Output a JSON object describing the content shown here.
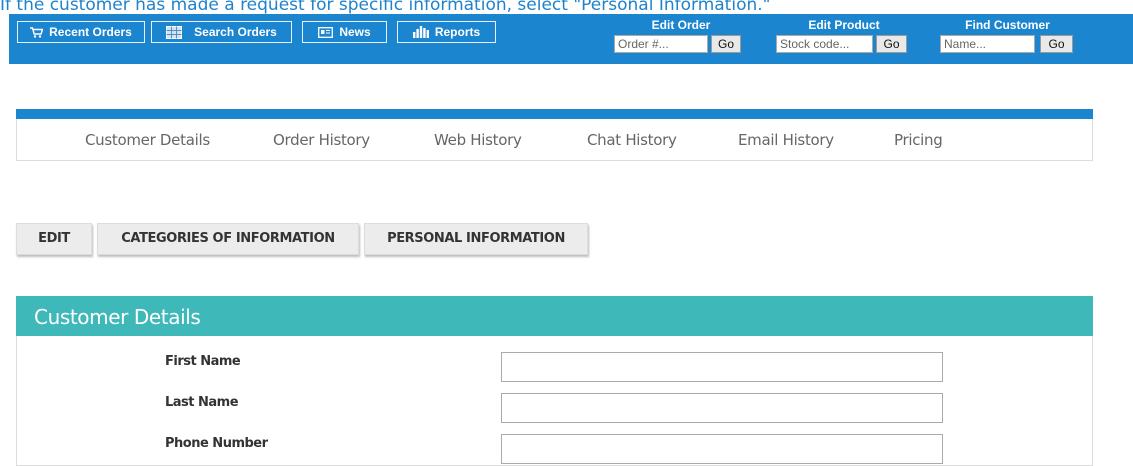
{
  "instruction": "If the customer has made a request for specific information, select \"Personal Information.\"",
  "topbar": {
    "nav": [
      {
        "label": "Recent Orders",
        "icon": "cart-icon"
      },
      {
        "label": "Search Orders",
        "icon": "grid-icon"
      },
      {
        "label": "News",
        "icon": "newspaper-icon"
      },
      {
        "label": "Reports",
        "icon": "bar-chart-icon"
      }
    ],
    "quick": [
      {
        "title": "Edit Order",
        "placeholder": "Order #...",
        "button": "Go"
      },
      {
        "title": "Edit Product",
        "placeholder": "Stock code...",
        "button": "Go"
      },
      {
        "title": "Find Customer",
        "placeholder": "Name...",
        "button": "Go"
      }
    ]
  },
  "tabs": [
    "Customer Details",
    "Order History",
    "Web History",
    "Chat History",
    "Email History",
    "Pricing"
  ],
  "actions": [
    "EDIT",
    "CATEGORIES OF INFORMATION",
    "PERSONAL INFORMATION"
  ],
  "panel": {
    "title": "Customer Details",
    "fields": [
      {
        "label": "First Name",
        "value": ""
      },
      {
        "label": "Last Name",
        "value": ""
      },
      {
        "label": "Phone Number",
        "value": ""
      }
    ]
  },
  "colors": {
    "topbar": "#1c85d0",
    "panel_header": "#3eb8b8",
    "instruction_text": "#1e83cc"
  }
}
